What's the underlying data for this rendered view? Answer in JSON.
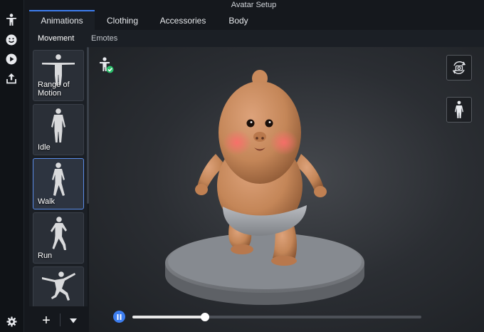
{
  "window": {
    "title": "Avatar Setup"
  },
  "rail": {
    "items": [
      {
        "name": "avatar-rail-icon"
      },
      {
        "name": "emote-rail-icon"
      },
      {
        "name": "play-rail-icon"
      },
      {
        "name": "upload-rail-icon"
      }
    ],
    "settings": "gear-icon"
  },
  "tabs": [
    {
      "label": "Animations",
      "active": true
    },
    {
      "label": "Clothing",
      "active": false
    },
    {
      "label": "Accessories",
      "active": false
    },
    {
      "label": "Body",
      "active": false
    }
  ],
  "subtabs": [
    {
      "label": "Movement",
      "active": true
    },
    {
      "label": "Emotes",
      "active": false
    }
  ],
  "animations": [
    {
      "label": "Range of Motion",
      "pose": "tpose",
      "active": false
    },
    {
      "label": "Idle",
      "pose": "idle",
      "active": false
    },
    {
      "label": "Walk",
      "pose": "walk",
      "active": true
    },
    {
      "label": "Run",
      "pose": "run",
      "active": false
    },
    {
      "label": "",
      "pose": "jump",
      "active": false
    }
  ],
  "bottom_bar": {
    "add_label": "+",
    "more_icon": "chevron-down-icon"
  },
  "playback": {
    "state": "playing",
    "progress": 0.25
  },
  "colors": {
    "accent": "#3d7ef0",
    "panel": "#1b1f25",
    "skin": "#c98d62"
  }
}
